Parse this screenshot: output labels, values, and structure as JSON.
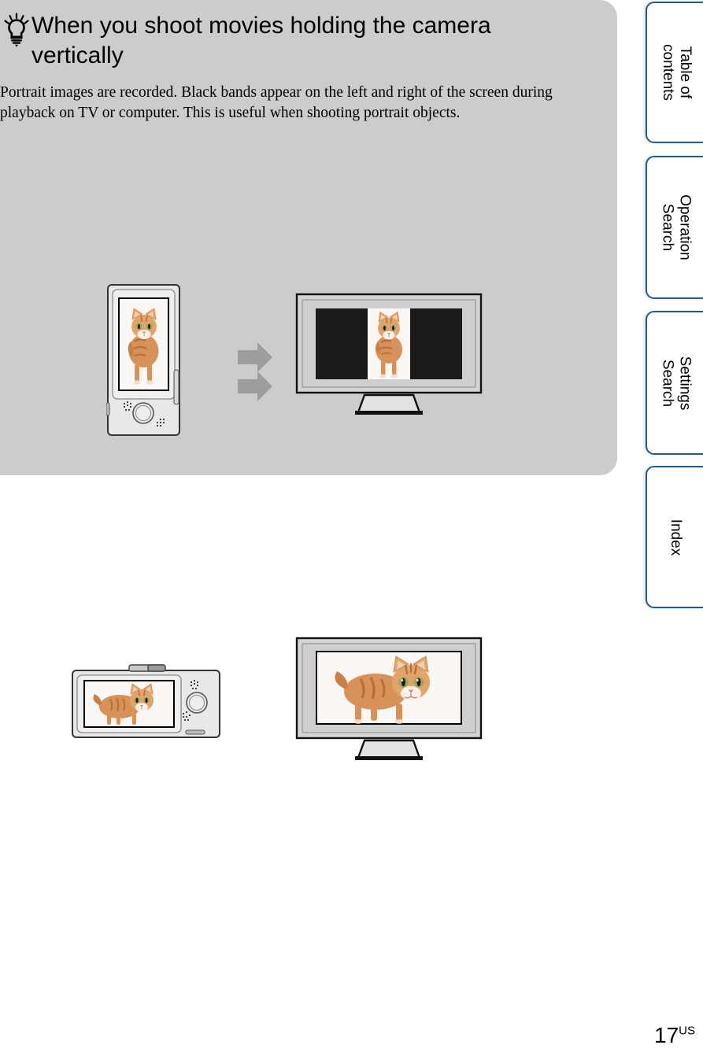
{
  "page": {
    "number": "17",
    "region_suffix": "US"
  },
  "tip_panel": {
    "icon": "lightbulb-tip-icon",
    "heading": "When you shoot movies holding the camera vertically",
    "body": "Portrait images are recorded. Black bands appear on the left and right of the screen during playback on TV or computer. This is useful when shooting portrait objects.",
    "background_color": "#cccccc"
  },
  "figures": [
    {
      "id": "figure-vertical-shooting",
      "source_device": {
        "name": "camera-held-vertically",
        "orientation": "portrait",
        "screen_content": "cat-photo-portrait"
      },
      "arrow": "arrow-right-icon",
      "result_device": {
        "name": "tv-display",
        "orientation": "landscape",
        "screen_content": "cat-photo-portrait-with-black-bands",
        "band_color": "#1a1a1a"
      }
    },
    {
      "id": "figure-horizontal-shooting",
      "source_device": {
        "name": "camera-held-horizontally",
        "orientation": "landscape",
        "screen_content": "cat-photo-landscape"
      },
      "arrow": "arrow-right-icon",
      "result_device": {
        "name": "tv-display",
        "orientation": "landscape",
        "screen_content": "cat-photo-landscape-fullscreen"
      }
    }
  ],
  "side_tabs": {
    "accent_color": "#1d5a96",
    "items": [
      {
        "label": "Table of\ncontents"
      },
      {
        "label": "Operation\nSearch"
      },
      {
        "label": "Settings\nSearch"
      },
      {
        "label": "Index"
      }
    ]
  }
}
